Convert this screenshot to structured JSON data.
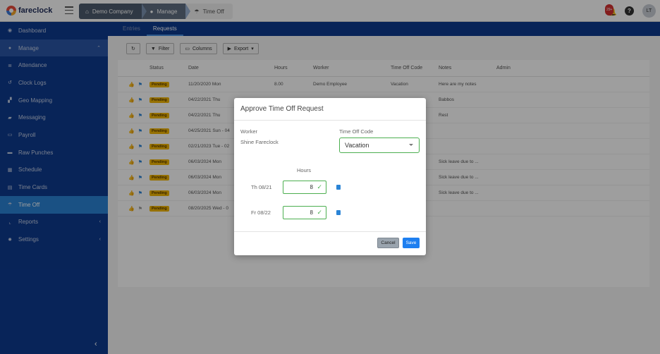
{
  "app": {
    "logo_text": "fareclock"
  },
  "breadcrumbs": [
    {
      "label": "Demo Company",
      "icon": "home-icon"
    },
    {
      "label": "Manage",
      "icon": "user-icon"
    },
    {
      "label": "Time Off",
      "icon": "umbrella-icon"
    }
  ],
  "header": {
    "notification_badge": "29+",
    "help_label": "?",
    "avatar_initials": "LT"
  },
  "sidebar": {
    "items": [
      {
        "label": "Dashboard",
        "icon": "dashboard-icon"
      },
      {
        "label": "Manage",
        "icon": "user-icon",
        "arrow": "⌃"
      },
      {
        "label": "Attendance",
        "icon": "list-icon"
      },
      {
        "label": "Clock Logs",
        "icon": "history-icon"
      },
      {
        "label": "Geo Mapping",
        "icon": "map-icon"
      },
      {
        "label": "Messaging",
        "icon": "chat-icon"
      },
      {
        "label": "Payroll",
        "icon": "money-icon"
      },
      {
        "label": "Raw Punches",
        "icon": "car-icon"
      },
      {
        "label": "Schedule",
        "icon": "calendar-icon"
      },
      {
        "label": "Time Cards",
        "icon": "card-icon"
      },
      {
        "label": "Time Off",
        "icon": "umbrella-icon"
      },
      {
        "label": "Reports",
        "icon": "chart-icon",
        "arrow": "‹"
      },
      {
        "label": "Settings",
        "icon": "gear-icon",
        "arrow": "‹"
      }
    ],
    "collapse_glyph": "‹"
  },
  "tabs": [
    {
      "label": "Entries"
    },
    {
      "label": "Requests"
    }
  ],
  "toolbar": {
    "refresh": "",
    "filter": "Filter",
    "columns": "Columns",
    "export": "Export"
  },
  "table": {
    "headers": [
      "",
      "Status",
      "Date",
      "Hours",
      "Worker",
      "Time Off Code",
      "Notes",
      "Admin"
    ],
    "rows": [
      {
        "status": "Pending",
        "date": "11/20/2020 Mon",
        "hours": "8.00",
        "worker": "Demo Employee",
        "code": "Vacation",
        "notes": "Here are my notes"
      },
      {
        "status": "Pending",
        "date": "04/22/2021 Thu",
        "hours": "",
        "worker": "",
        "code": "",
        "notes": "Babbos"
      },
      {
        "status": "Pending",
        "date": "04/22/2021 Thu",
        "hours": "",
        "worker": "",
        "code": "",
        "notes": "Rest"
      },
      {
        "status": "Pending",
        "date": "04/25/2021 Sun - 04",
        "hours": "",
        "worker": "",
        "code": "",
        "notes": ""
      },
      {
        "status": "Pending",
        "date": "02/21/2023 Tue - 02",
        "hours": "",
        "worker": "",
        "code": "",
        "notes": ""
      },
      {
        "status": "Pending",
        "date": "06/03/2024 Mon",
        "hours": "",
        "worker": "",
        "code": "",
        "notes": "Sick leave due to ..."
      },
      {
        "status": "Pending",
        "date": "06/03/2024 Mon",
        "hours": "",
        "worker": "",
        "code": "",
        "notes": "Sick leave due to ..."
      },
      {
        "status": "Pending",
        "date": "06/03/2024 Mon",
        "hours": "",
        "worker": "",
        "code": "",
        "notes": "Sick leave due to ..."
      },
      {
        "status": "Pending",
        "date": "08/20/2025 Wed - 0",
        "hours": "",
        "worker": "",
        "code": "",
        "notes": ""
      }
    ]
  },
  "modal": {
    "title": "Approve Time Off Request",
    "worker_label": "Worker",
    "worker_value": "Shine Fareclock",
    "code_label": "Time Off Code",
    "code_value": "Vacation",
    "hours_label": "Hours",
    "days": [
      {
        "label": "Th 08/21",
        "value": "8"
      },
      {
        "label": "Fr 08/22",
        "value": "8"
      }
    ],
    "cancel_label": "Cancel",
    "save_label": "Save"
  },
  "colors": {
    "sidebar_bg": "#0d3a8f",
    "accent": "#1e7ff0",
    "pending": "#f2b705",
    "success": "#4caf50"
  }
}
